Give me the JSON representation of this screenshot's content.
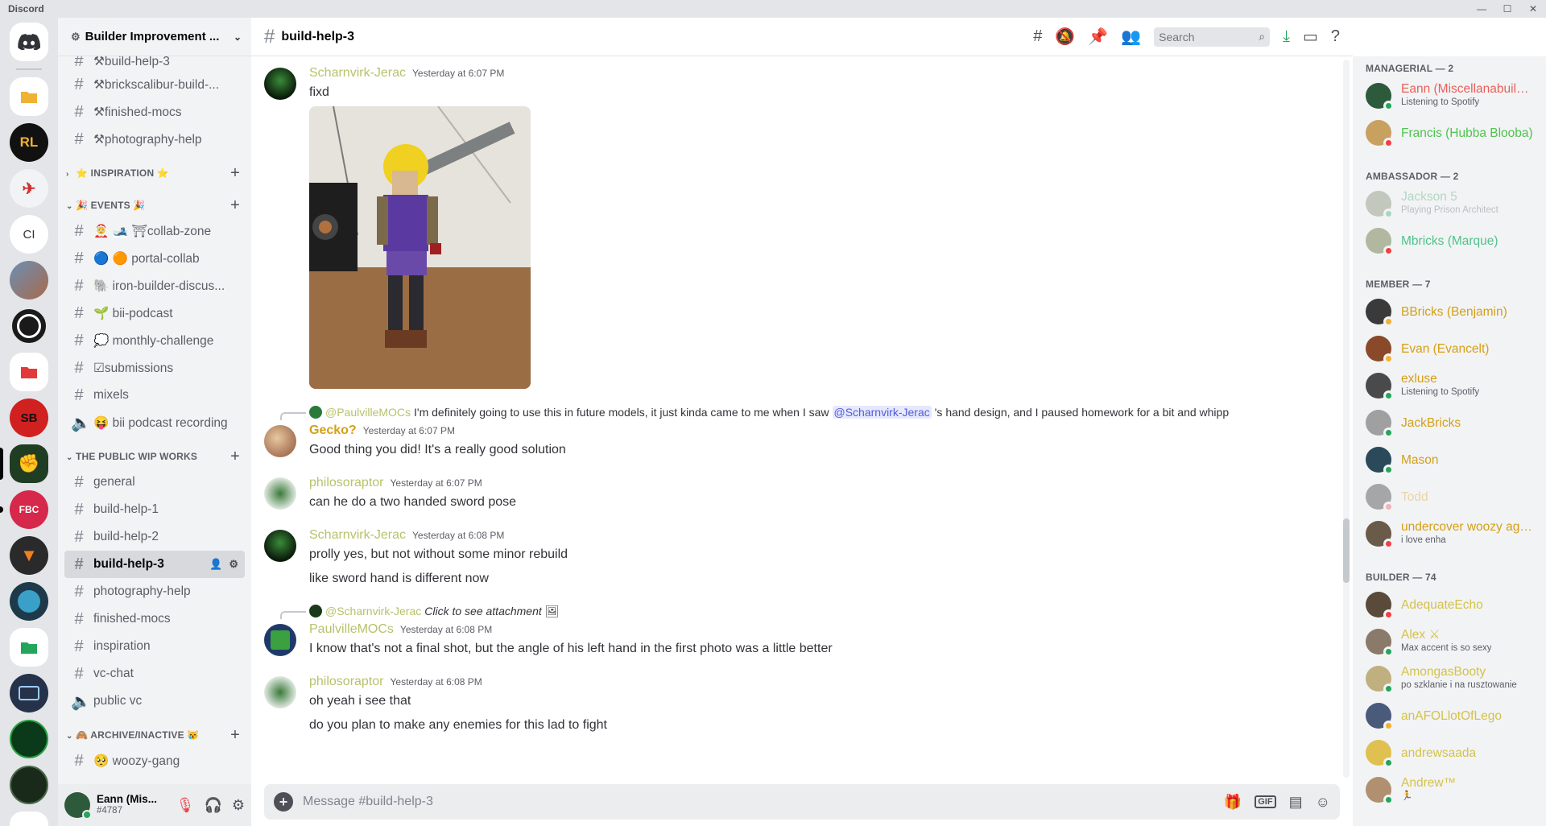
{
  "window": {
    "app_name": "Discord",
    "controls": [
      "—",
      "☐",
      "✕"
    ]
  },
  "colors": {
    "blurple": "#5865f2",
    "online": "#23a55a",
    "idle": "#f0b232",
    "dnd": "#f23f43",
    "gold_role": "#d4a017",
    "green_role": "#3ba55c"
  },
  "rail": {
    "text_server": "CI",
    "server_labels": [
      "RL",
      "FBC",
      "SB"
    ]
  },
  "sidebar": {
    "server_name": "Builder Improvement ...",
    "top_channels": [
      {
        "label": "⚒build-help-3"
      },
      {
        "label": "⚒brickscalibur-build-..."
      },
      {
        "label": "⚒finished-mocs"
      },
      {
        "label": "⚒photography-help"
      }
    ],
    "cat_inspiration": "⭐ INSPIRATION ⭐",
    "cat_events": "🎉 EVENTS 🎉",
    "events_channels": [
      {
        "label": "🤶 🎿 ⛩collab-zone"
      },
      {
        "label": "🔵 🟠 portal-collab"
      },
      {
        "label": "🐘 iron-builder-discus..."
      },
      {
        "label": "🌱 bii-podcast"
      },
      {
        "label": "💭 monthly-challenge"
      },
      {
        "label": "☑submissions"
      },
      {
        "label": "mixels"
      },
      {
        "label": "😝 bii podcast recording"
      }
    ],
    "cat_wip": "THE PUBLIC WIP WORKS",
    "wip_channels": [
      {
        "label": "general"
      },
      {
        "label": "build-help-1"
      },
      {
        "label": "build-help-2"
      },
      {
        "label": "build-help-3"
      },
      {
        "label": "photography-help"
      },
      {
        "label": "finished-mocs"
      },
      {
        "label": "inspiration"
      },
      {
        "label": "vc-chat"
      },
      {
        "label": "public vc"
      }
    ],
    "cat_archive": "🙈 ARCHIVE/INACTIVE 😿",
    "archive_channels": [
      {
        "label": "🥺 woozy-gang"
      }
    ],
    "user": {
      "name": "Eann (Mis...",
      "discriminator": "#4787"
    }
  },
  "header": {
    "channel": "build-help-3",
    "search_placeholder": "Search"
  },
  "messages": [
    {
      "author": "Scharnvirk-Jerac",
      "time": "Yesterday at 6:07 PM",
      "lines": [
        "fixd"
      ]
    },
    {
      "reply_to": "@PaulvilleMOCs",
      "reply_text_a": "I'm definitely going to use this in future models, it just kinda came to me when I saw ",
      "reply_mention": "@Scharnvirk-Jerac",
      "reply_text_b": "'s hand design, and I paused homework for a bit and whipp",
      "author": "Gecko?",
      "time": "Yesterday at 6:07 PM",
      "lines": [
        "Good thing you did! It's a really good solution"
      ]
    },
    {
      "author": "philosoraptor",
      "time": "Yesterday at 6:07 PM",
      "lines": [
        "can he do a two handed sword pose"
      ]
    },
    {
      "author": "Scharnvirk-Jerac",
      "time": "Yesterday at 6:08 PM",
      "lines": [
        "prolly yes, but not without some minor rebuild",
        "like sword hand is different now"
      ]
    },
    {
      "reply_to": "@Scharnvirk-Jerac",
      "reply_text_a": "Click to see attachment",
      "author": "PaulvilleMOCs",
      "time": "Yesterday at 6:08 PM",
      "lines": [
        "I know that's not a final shot, but the angle of his left hand in the first photo was a little better"
      ]
    },
    {
      "author": "philosoraptor",
      "time": "Yesterday at 6:08 PM",
      "lines": [
        "oh yeah i see that",
        "do you plan to make any enemies for this lad to fight"
      ]
    }
  ],
  "composer": {
    "placeholder": "Message #build-help-3",
    "gif_label": "GIF"
  },
  "members": {
    "groups": [
      {
        "label": "MANAGERIAL — 2",
        "items": [
          {
            "name": "Eann (Miscellanabuilds)",
            "status_text": "Listening to Spotify",
            "color": "#e8605a",
            "presence": "online"
          },
          {
            "name": "Francis (Hubba Blooba)",
            "status_text": "",
            "color": "#4fc34f",
            "presence": "dnd"
          }
        ]
      },
      {
        "label": "AMBASSADOR — 2",
        "items": [
          {
            "name": "Jackson 5",
            "status_text": "Playing Prison Architect",
            "color": "#3ba55c",
            "presence": "online",
            "offline": true
          },
          {
            "name": "Mbricks (Marque)",
            "status_text": "",
            "color": "#4fc38a",
            "presence": "dnd"
          }
        ]
      },
      {
        "label": "MEMBER — 7",
        "items": [
          {
            "name": "BBricks (Benjamin)",
            "status_text": "",
            "color": "#d4a017",
            "presence": "idle"
          },
          {
            "name": "Evan (Evancelt)",
            "status_text": "",
            "color": "#d4a017",
            "presence": "idle"
          },
          {
            "name": "exluse",
            "status_text": "Listening to Spotify",
            "color": "#d4a017",
            "presence": "online"
          },
          {
            "name": "JackBricks",
            "status_text": "",
            "color": "#d4a017",
            "presence": "online"
          },
          {
            "name": "Mason",
            "status_text": "",
            "color": "#d4a017",
            "presence": "online"
          },
          {
            "name": "Todd",
            "status_text": "",
            "color": "#d4a017",
            "presence": "dnd",
            "offline": true
          },
          {
            "name": "undercover woozy age...",
            "status_text": "i love enha",
            "color": "#d4a017",
            "presence": "dnd"
          }
        ]
      },
      {
        "label": "BUILDER — 74",
        "items": [
          {
            "name": "AdequateEcho",
            "status_text": "",
            "color": "#d4c24a",
            "presence": "dnd"
          },
          {
            "name": "Alex ⚔",
            "status_text": "Max accent is so sexy",
            "color": "#d4c24a",
            "presence": "online"
          },
          {
            "name": "AmongasBooty",
            "status_text": "po szklanie i na rusztowanie",
            "color": "#d4c24a",
            "presence": "online"
          },
          {
            "name": "anAFOLlotOfLego",
            "status_text": "",
            "color": "#d4c24a",
            "presence": "idle"
          },
          {
            "name": "andrewsaada",
            "status_text": "",
            "color": "#d4c24a",
            "presence": "online"
          },
          {
            "name": "Andrew™",
            "status_text": "🏃",
            "color": "#d4c24a",
            "presence": "online"
          }
        ]
      }
    ]
  }
}
